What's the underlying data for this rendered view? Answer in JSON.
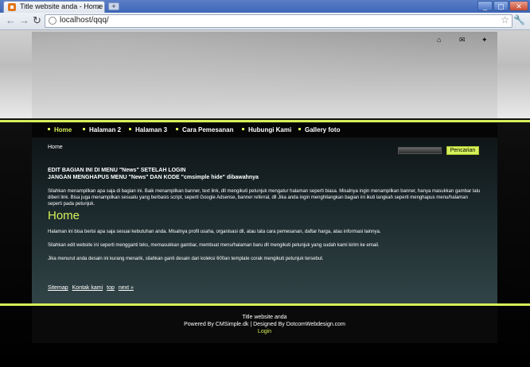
{
  "browser": {
    "tab_title": "Title website anda - Home",
    "tab_close": "x",
    "new_tab": "+",
    "url": "localhost/qqq/",
    "window_buttons": [
      "_",
      "▢",
      "✕"
    ]
  },
  "header_icons": [
    "home-icon",
    "mail-icon",
    "sitemap-icon"
  ],
  "nav": {
    "items": [
      "Home",
      "Halaman 2",
      "Halaman 3",
      "Cara Pemesanan",
      "Hubungi Kami",
      "Gallery foto"
    ],
    "active": "Home"
  },
  "content": {
    "breadcrumb": "Home",
    "search_button": "Pencarian",
    "notice_line1": "EDIT BAGIAN INI DI MENU \"News\" SETELAH LOGIN",
    "notice_line2": "JANGAN MENGHAPUS MENU \"News\" DAN KODE \"cmsimple hide\" dibawahnya",
    "intro": "Silahkan menampilkan apa saja di bagian ini. Baik menampilkan banner, text link, dll mengikuti petunjuk mengatur halaman seperti biasa. Misalnya ingin menampilkan banner, hanya masukkan gambar lalu diberi link. Bisa juga menampilkan sesuatu yang berbasis script, seperti Google Adsense, banner referral, dll Jika anda ingin menghilangkan bagian ini ikuti langkah seperti menghapus menu/halaman seperti pada petunjuk.",
    "page_title": "Home",
    "para1": "Halaman ini bisa berisi apa saja sesuai kebutuhan anda. Misalnya profil usaha, organisasi dll, atau tata cara pemesanan, daftar harga, atau informasi lainnya.",
    "para2": "Silahkan edit website ini seperti mengganti teks, memasukkan gambar, membuat menu/halaman baru dll mengikuti petunjuk yang sudah kami kirim ke email.",
    "para3": "Jika menurut anda desain ini kurang menarik, silahkan ganti desain dari koleksi 600an template corak mengikuti petunjuk tersebut.",
    "link_sitemap": "Sitemap",
    "link_contact": "Kontak kami",
    "link_top": "top",
    "link_next": "next »"
  },
  "footer": {
    "title": "Title website anda",
    "credits": "Powered By CMSimple.dk | Designed By DotcomWebdesign.com",
    "login": "Login"
  },
  "colors": {
    "accent": "#d6f05a"
  }
}
